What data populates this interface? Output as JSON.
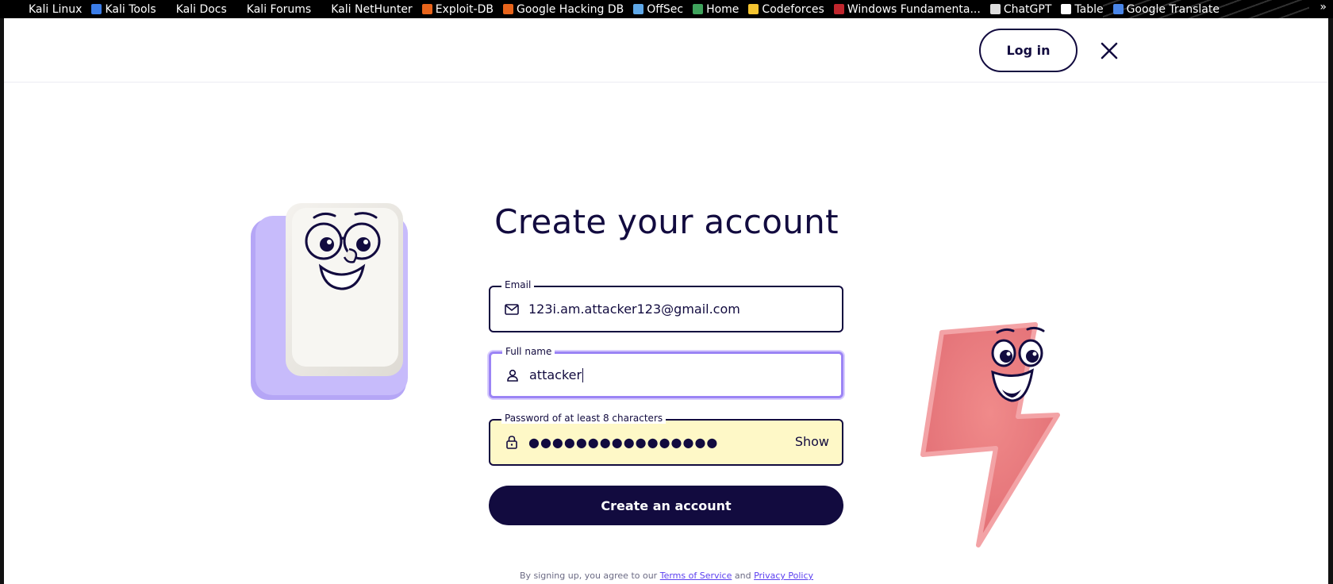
{
  "bookmarks": [
    {
      "label": "Kali Linux",
      "icon": "none",
      "color": ""
    },
    {
      "label": "Kali Tools",
      "icon": "kali-tools-icon",
      "color": "#3b7de8"
    },
    {
      "label": "Kali Docs",
      "icon": "none",
      "color": ""
    },
    {
      "label": "Kali Forums",
      "icon": "none",
      "color": ""
    },
    {
      "label": "Kali NetHunter",
      "icon": "none",
      "color": ""
    },
    {
      "label": "Exploit-DB",
      "icon": "exploit-db-icon",
      "color": "#e8641b"
    },
    {
      "label": "Google Hacking DB",
      "icon": "ghdb-icon",
      "color": "#e8641b"
    },
    {
      "label": "OffSec",
      "icon": "offsec-icon",
      "color": "#5fa8e8"
    },
    {
      "label": "Home",
      "icon": "home-icon",
      "color": "#3fa35c"
    },
    {
      "label": "Codeforces",
      "icon": "codeforces-icon",
      "color": "#f4c430"
    },
    {
      "label": "Windows Fundamenta...",
      "icon": "tryhackme-icon",
      "color": "#c0262d"
    },
    {
      "label": "ChatGPT",
      "icon": "chatgpt-icon",
      "color": "#dddddd"
    },
    {
      "label": "Table",
      "icon": "notion-icon",
      "color": "#ffffff"
    },
    {
      "label": "Google Translate",
      "icon": "google-translate-icon",
      "color": "#4a86e8"
    }
  ],
  "bookmarks_overflow": "»",
  "header": {
    "login_label": "Log in"
  },
  "page": {
    "title": "Create your account"
  },
  "form": {
    "email": {
      "legend": "Email",
      "value": "123i.am.attacker123@gmail.com",
      "icon": "mail-icon"
    },
    "full_name": {
      "legend": "Full name",
      "value": "attacker",
      "icon": "person-icon"
    },
    "password": {
      "legend": "Password of at least 8 characters",
      "value": "●●●●●●●●●●●●●●●●",
      "icon": "lock-icon",
      "show_label": "Show"
    },
    "submit_label": "Create an account"
  },
  "legal": {
    "prefix": "By signing up, you agree to our ",
    "terms": "Terms of Service",
    "middle": " and ",
    "privacy": "Privacy Policy"
  },
  "colors": {
    "navy": "#120b3f",
    "focus": "#9b84f5",
    "autofill": "#fef8c7",
    "link": "#5b3ff0"
  }
}
